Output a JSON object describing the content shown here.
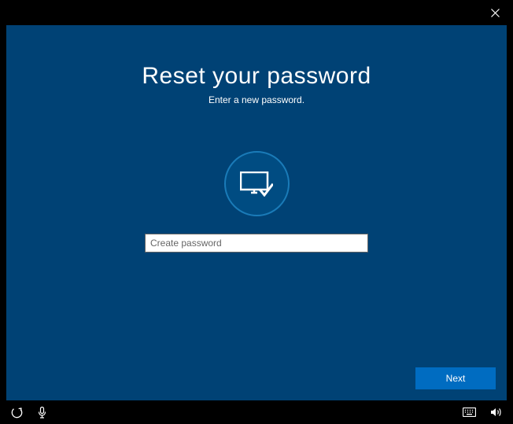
{
  "title": "Reset your password",
  "subtitle": "Enter a new password.",
  "input": {
    "placeholder": "Create password",
    "value": ""
  },
  "next_label": "Next"
}
